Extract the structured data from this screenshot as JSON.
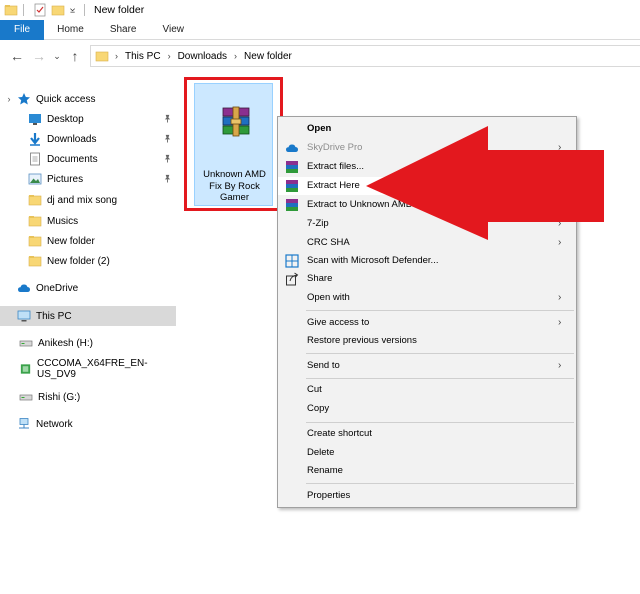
{
  "window": {
    "title": "New folder"
  },
  "ribbon": {
    "tabs": [
      "File",
      "Home",
      "Share",
      "View"
    ]
  },
  "address": {
    "crumbs": [
      "This PC",
      "Downloads",
      "New folder"
    ]
  },
  "nav": {
    "quick_access": "Quick access",
    "items": [
      {
        "label": "Desktop",
        "pinned": true
      },
      {
        "label": "Downloads",
        "pinned": true
      },
      {
        "label": "Documents",
        "pinned": true
      },
      {
        "label": "Pictures",
        "pinned": true
      },
      {
        "label": "dj and mix song",
        "pinned": false
      },
      {
        "label": "Musics",
        "pinned": false
      },
      {
        "label": "New folder",
        "pinned": false
      },
      {
        "label": "New folder (2)",
        "pinned": false
      }
    ],
    "onedrive": "OneDrive",
    "this_pc": "This PC",
    "drives": [
      "Anikesh (H:)",
      "CCCOMA_X64FRE_EN-US_DV9",
      "Rishi (G:)"
    ],
    "network": "Network"
  },
  "file": {
    "name": "Unknown AMD Fix By Rock Gamer",
    "name_lines": [
      "Unknown AMD",
      "Fix By Rock",
      "Gamer"
    ],
    "icon": "winrar-archive-icon"
  },
  "context_menu": {
    "open": "Open",
    "skydrive": "SkyDrive Pro",
    "extract_files": "Extract files...",
    "extract_here": "Extract Here",
    "extract_to": "Extract to Unknown AMD",
    "seven_zip": "7-Zip",
    "crc_sha": "CRC SHA",
    "scan": "Scan with Microsoft Defender...",
    "share": "Share",
    "open_with": "Open with",
    "give_access": "Give access to",
    "restore": "Restore previous versions",
    "send_to": "Send to",
    "cut": "Cut",
    "copy": "Copy",
    "create_shortcut": "Create shortcut",
    "delete": "Delete",
    "rename": "Rename",
    "properties": "Properties"
  },
  "colors": {
    "file_tab": "#1979ca",
    "annotation_red": "#e3181e",
    "selection": "#cce8ff",
    "folder": "#f8d775"
  }
}
